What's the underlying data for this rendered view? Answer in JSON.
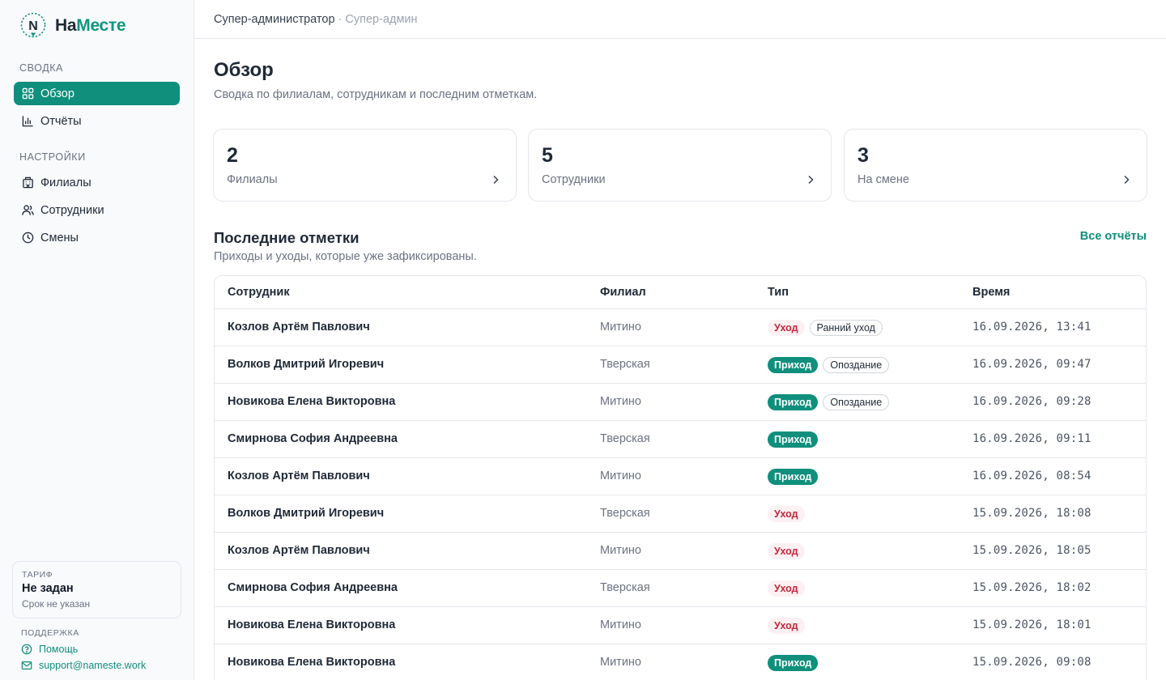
{
  "brand": {
    "part1": "На",
    "part2": "Месте",
    "letter": "N",
    "accent": "#0f8f7c"
  },
  "sidebar": {
    "section_summary": "СВОДКА",
    "section_settings": "НАСТРОЙКИ",
    "items": [
      {
        "label": "Обзор",
        "icon": "grid-icon",
        "active": true
      },
      {
        "label": "Отчёты",
        "icon": "bar-chart-icon"
      },
      {
        "label": "Филиалы",
        "icon": "building-icon"
      },
      {
        "label": "Сотрудники",
        "icon": "users-icon"
      },
      {
        "label": "Смены",
        "icon": "clock-icon"
      }
    ],
    "tariff": {
      "label": "ТАРИФ",
      "value": "Не задан",
      "sub": "Срок не указан"
    },
    "support": {
      "label": "ПОДДЕРЖКА",
      "help": "Помощь",
      "email": "support@nameste.work"
    }
  },
  "breadcrumb": {
    "role": "Супер-администратор",
    "sep": "·",
    "user": "Супер-админ"
  },
  "page": {
    "title": "Обзор",
    "subtitle": "Сводка по филиалам, сотрудникам и последним отметкам."
  },
  "cards": [
    {
      "value": "2",
      "label": "Филиалы"
    },
    {
      "value": "5",
      "label": "Сотрудники"
    },
    {
      "value": "3",
      "label": "На смене"
    }
  ],
  "recent": {
    "title": "Последние отметки",
    "subtitle": "Приходы и уходы, которые уже зафиксированы.",
    "all_link": "Все отчёты",
    "columns": [
      "Сотрудник",
      "Филиал",
      "Тип",
      "Время"
    ],
    "rows": [
      {
        "name": "Козлов Артём Павлович",
        "branch": "Митино",
        "type": "Уход",
        "kind": "out",
        "note": "Ранний уход",
        "time": "16.09.2026, 13:41"
      },
      {
        "name": "Волков Дмитрий Игоревич",
        "branch": "Тверская",
        "type": "Приход",
        "kind": "in",
        "note": "Опоздание",
        "time": "16.09.2026, 09:47"
      },
      {
        "name": "Новикова Елена Викторовна",
        "branch": "Митино",
        "type": "Приход",
        "kind": "in",
        "note": "Опоздание",
        "time": "16.09.2026, 09:28"
      },
      {
        "name": "Смирнова София Андреевна",
        "branch": "Тверская",
        "type": "Приход",
        "kind": "in",
        "note": "",
        "time": "16.09.2026, 09:11"
      },
      {
        "name": "Козлов Артём Павлович",
        "branch": "Митино",
        "type": "Приход",
        "kind": "in",
        "note": "",
        "time": "16.09.2026, 08:54"
      },
      {
        "name": "Волков Дмитрий Игоревич",
        "branch": "Тверская",
        "type": "Уход",
        "kind": "out",
        "note": "",
        "time": "15.09.2026, 18:08"
      },
      {
        "name": "Козлов Артём Павлович",
        "branch": "Митино",
        "type": "Уход",
        "kind": "out",
        "note": "",
        "time": "15.09.2026, 18:05"
      },
      {
        "name": "Смирнова София Андреевна",
        "branch": "Тверская",
        "type": "Уход",
        "kind": "out",
        "note": "",
        "time": "15.09.2026, 18:02"
      },
      {
        "name": "Новикова Елена Викторовна",
        "branch": "Митино",
        "type": "Уход",
        "kind": "out",
        "note": "",
        "time": "15.09.2026, 18:01"
      },
      {
        "name": "Новикова Елена Викторовна",
        "branch": "Митино",
        "type": "Приход",
        "kind": "in",
        "note": "",
        "time": "15.09.2026, 09:08"
      }
    ]
  }
}
